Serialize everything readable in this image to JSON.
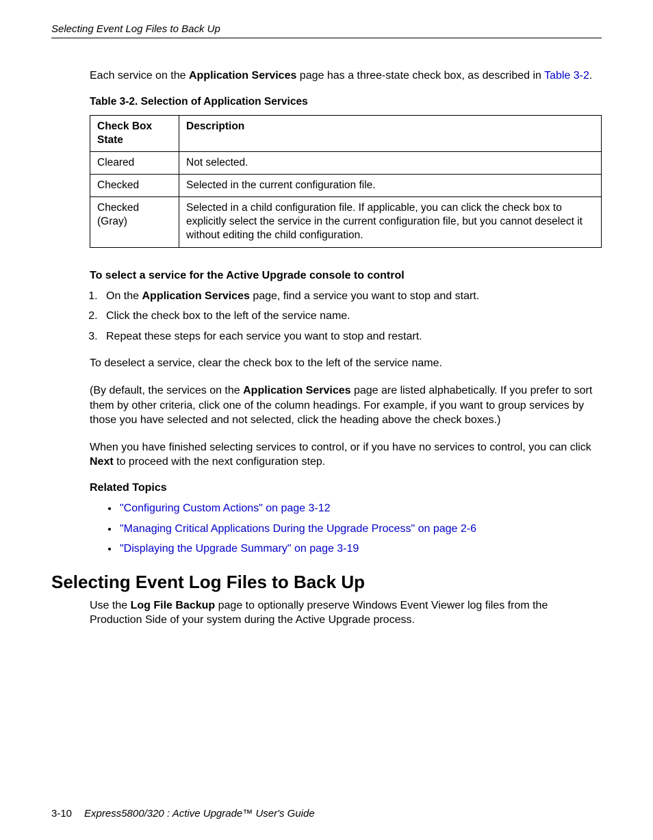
{
  "running_header": "Selecting Event Log Files to Back Up",
  "intro": {
    "pre": "Each service on the ",
    "bold": "Application Services",
    "mid": " page has a three-state check box, as described in ",
    "link": "Table 3-2",
    "post": "."
  },
  "table_caption": "Table 3-2. Selection of Application Services",
  "table": {
    "headers": [
      "Check Box State",
      "Description"
    ],
    "rows": [
      [
        "Cleared",
        "Not selected."
      ],
      [
        "Checked",
        "Selected in the current configuration file."
      ],
      [
        "Checked (Gray)",
        "Selected in a child configuration file. If applicable, you can click the check box to explicitly select the service in the current configuration file, but you cannot deselect it without editing the child configuration."
      ]
    ]
  },
  "proc_heading": "To select a service for the Active Upgrade console to control",
  "steps": {
    "s1_pre": "On the ",
    "s1_bold": "Application Services",
    "s1_post": " page, find a service you want to stop and start.",
    "s2": "Click the check box to the left of the service name.",
    "s3": "Repeat these steps for each service you want to stop and restart."
  },
  "deselect_para": "To deselect a service, clear the check box to the left of the service name.",
  "default_para": {
    "pre": "(By default, the services on the ",
    "bold": "Application Services",
    "post": " page are listed alphabetically. If you prefer to sort them by other criteria, click one of the column headings. For example, if you want to group services by those you have selected and not selected, click the heading above the check boxes.)"
  },
  "finish_para": {
    "pre": "When you have finished selecting services to control, or if you have no services to control, you can click ",
    "bold": "Next",
    "post": " to proceed with the next configuration step."
  },
  "related_heading": "Related Topics",
  "related": [
    "\"Configuring Custom Actions\" on page 3-12",
    "\"Managing Critical Applications During the Upgrade Process\" on page 2-6",
    "\"Displaying the Upgrade Summary\" on page 3-19"
  ],
  "section_heading": "Selecting Event Log Files to Back Up",
  "section_para": {
    "pre": "Use the ",
    "bold": "Log File Backup",
    "post": " page to optionally preserve Windows Event Viewer log files from the Production Side of your system during the Active Upgrade process."
  },
  "footer": {
    "pagenum": "3-10",
    "title": "Express5800/320    : Active Upgrade™ User's Guide"
  }
}
